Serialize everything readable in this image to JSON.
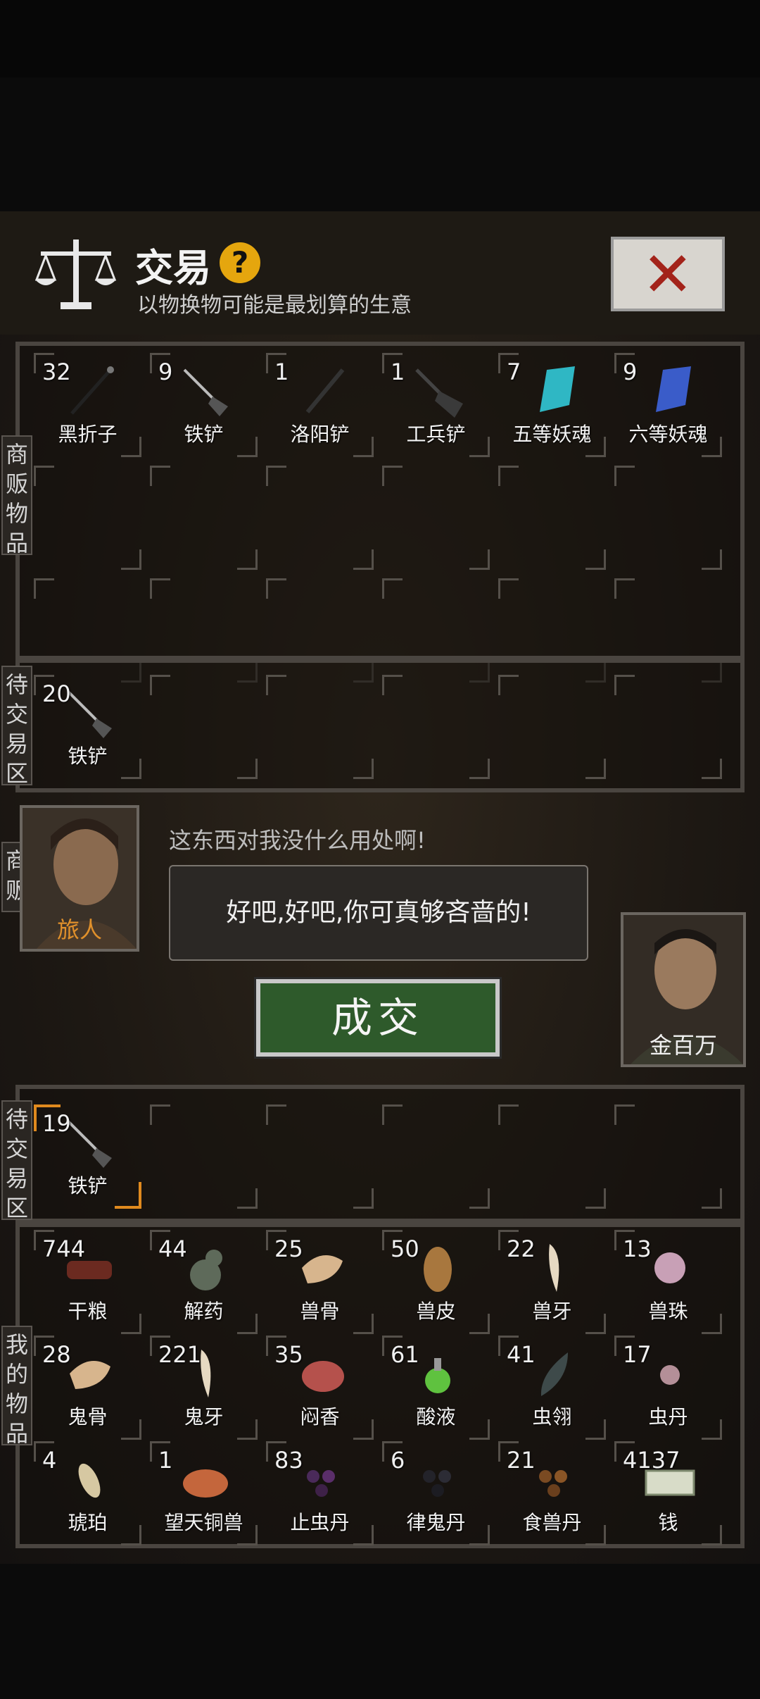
{
  "header": {
    "title": "交易",
    "help_icon": "question-icon",
    "subtitle": "以物换物可能是最划算的生意",
    "close_icon": "close-icon"
  },
  "merchant_items": {
    "label": "商贩物品",
    "items": [
      {
        "count": "32",
        "name": "黑折子",
        "icon": "torch-icon"
      },
      {
        "count": "9",
        "name": "铁铲",
        "icon": "shovel-icon"
      },
      {
        "count": "1",
        "name": "洛阳铲",
        "icon": "luoyang-shovel-icon"
      },
      {
        "count": "1",
        "name": "工兵铲",
        "icon": "engineer-shovel-icon"
      },
      {
        "count": "7",
        "name": "五等妖魂",
        "icon": "crystal-cyan-icon"
      },
      {
        "count": "9",
        "name": "六等妖魂",
        "icon": "crystal-blue-icon"
      }
    ]
  },
  "merchant_pending": {
    "label": "待交易区",
    "items": [
      {
        "count": "20",
        "name": "铁铲",
        "icon": "shovel-icon"
      }
    ]
  },
  "dialog": {
    "merchant_label": "商贩",
    "trader_name": "旅人",
    "trader_line": "这东西对我没什么用处啊!",
    "bubble": "好吧,好吧,你可真够吝啬的!",
    "deal_button": "成交",
    "player_name": "金百万",
    "star": "★"
  },
  "player_pending": {
    "label": "待交易区",
    "items": [
      {
        "count": "19",
        "name": "铁铲",
        "icon": "shovel-icon"
      }
    ]
  },
  "my_items": {
    "label": "我的物品",
    "rows": [
      [
        {
          "count": "744",
          "name": "干粮",
          "icon": "jerky-icon"
        },
        {
          "count": "44",
          "name": "解药",
          "icon": "gourd-icon"
        },
        {
          "count": "25",
          "name": "兽骨",
          "icon": "bone-icon"
        },
        {
          "count": "50",
          "name": "兽皮",
          "icon": "hide-icon"
        },
        {
          "count": "22",
          "name": "兽牙",
          "icon": "fang-icon"
        },
        {
          "count": "13",
          "name": "兽珠",
          "icon": "pearl-icon"
        }
      ],
      [
        {
          "count": "28",
          "name": "鬼骨",
          "icon": "bone-icon"
        },
        {
          "count": "221",
          "name": "鬼牙",
          "icon": "fang-icon"
        },
        {
          "count": "35",
          "name": "闷香",
          "icon": "meat-icon"
        },
        {
          "count": "61",
          "name": "酸液",
          "icon": "flask-icon"
        },
        {
          "count": "41",
          "name": "虫翎",
          "icon": "feather-icon"
        },
        {
          "count": "17",
          "name": "虫丹",
          "icon": "pill-icon"
        }
      ],
      [
        {
          "count": "4",
          "name": "琥珀",
          "icon": "amber-icon"
        },
        {
          "count": "1",
          "name": "望天铜兽",
          "icon": "bronze-beast-icon"
        },
        {
          "count": "83",
          "name": "止虫丹",
          "icon": "pills-purple-icon"
        },
        {
          "count": "6",
          "name": "律鬼丹",
          "icon": "pills-dark-icon"
        },
        {
          "count": "21",
          "name": "食兽丹",
          "icon": "pills-brown-icon"
        },
        {
          "count": "4137",
          "name": "钱",
          "icon": "money-icon"
        }
      ]
    ]
  }
}
